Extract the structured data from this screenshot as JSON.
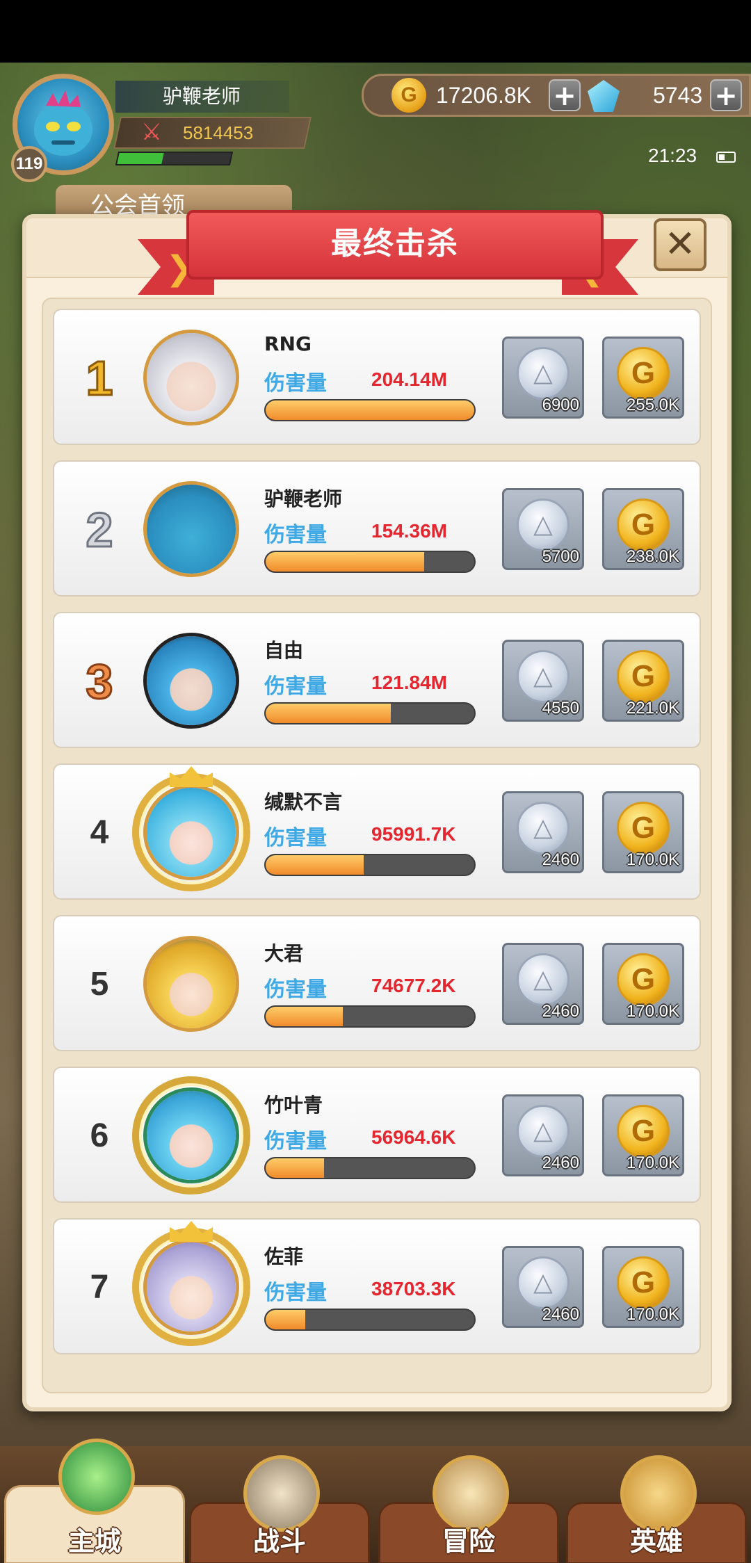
{
  "hud": {
    "player_name": "驴鞭老师",
    "power": "5814453",
    "level": "119",
    "gold": "17206.8K",
    "gems": "5743",
    "time": "21:23",
    "guild_tab": "公会首领"
  },
  "modal": {
    "title": "最终击杀",
    "close_icon": "close-icon"
  },
  "ranking": [
    {
      "rank": "1",
      "name": "RNG",
      "dmg_label": "伤害量",
      "damage": "204.14M",
      "bar_fraction": 1.0,
      "silver": "6900",
      "gold": "255.0K"
    },
    {
      "rank": "2",
      "name": "驴鞭老师",
      "dmg_label": "伤害量",
      "damage": "154.36M",
      "bar_fraction": 0.76,
      "silver": "5700",
      "gold": "238.0K"
    },
    {
      "rank": "3",
      "name": "自由",
      "dmg_label": "伤害量",
      "damage": "121.84M",
      "bar_fraction": 0.6,
      "silver": "4550",
      "gold": "221.0K"
    },
    {
      "rank": "4",
      "name": "缄默不言",
      "dmg_label": "伤害量",
      "damage": "95991.7K",
      "bar_fraction": 0.47,
      "silver": "2460",
      "gold": "170.0K"
    },
    {
      "rank": "5",
      "name": "大君",
      "dmg_label": "伤害量",
      "damage": "74677.2K",
      "bar_fraction": 0.37,
      "silver": "2460",
      "gold": "170.0K"
    },
    {
      "rank": "6",
      "name": "竹叶青",
      "dmg_label": "伤害量",
      "damage": "56964.6K",
      "bar_fraction": 0.28,
      "silver": "2460",
      "gold": "170.0K"
    },
    {
      "rank": "7",
      "name": "佐菲",
      "dmg_label": "伤害量",
      "damage": "38703.3K",
      "bar_fraction": 0.19,
      "silver": "2460",
      "gold": "170.0K"
    }
  ],
  "nav": [
    {
      "label": "主城",
      "icon": "city-icon"
    },
    {
      "label": "战斗",
      "icon": "swords-icon"
    },
    {
      "label": "冒险",
      "icon": "map-icon"
    },
    {
      "label": "英雄",
      "icon": "hero-icon"
    }
  ]
}
